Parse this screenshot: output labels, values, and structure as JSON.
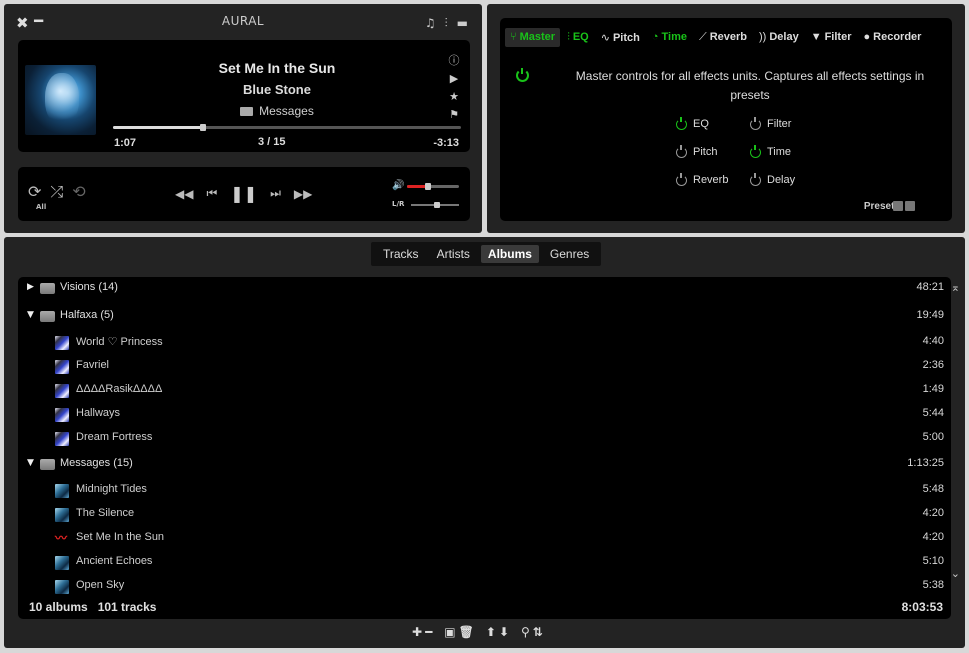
{
  "app": {
    "title": "AURAL"
  },
  "window": {
    "close_glyph": "✖",
    "minimize_glyph": "━"
  },
  "header_icons": [
    {
      "name": "playlist-view-icon",
      "glyph": "♫"
    },
    {
      "name": "effects-view-icon",
      "glyph": "⫶"
    },
    {
      "name": "layout-icon",
      "glyph": "▬"
    }
  ],
  "now_playing": {
    "title": "Set Me In the Sun",
    "artist": "Blue Stone",
    "album": "Messages",
    "elapsed": "1:07",
    "index": "3 / 15",
    "remaining": "-3:13",
    "progress_fraction": 0.26,
    "side_icons": [
      {
        "name": "info-icon",
        "glyph": "ⓘ"
      },
      {
        "name": "queue-icon",
        "glyph": "▶"
      },
      {
        "name": "favorite-icon",
        "glyph": "★"
      },
      {
        "name": "bookmark-icon",
        "glyph": "⚑"
      }
    ]
  },
  "controls": {
    "repeat_mode": "All",
    "left_icons": [
      {
        "name": "repeat-icon",
        "glyph": "⟳"
      },
      {
        "name": "shuffle-icon",
        "glyph": "⤮"
      },
      {
        "name": "shuffle-album-icon",
        "glyph": "⟲"
      }
    ],
    "transport": [
      {
        "name": "seek-backward-icon",
        "glyph": "◀◀"
      },
      {
        "name": "previous-track-icon",
        "glyph": "⏮"
      },
      {
        "name": "pause-icon",
        "glyph": "❚❚"
      },
      {
        "name": "next-track-icon",
        "glyph": "⏭"
      },
      {
        "name": "seek-forward-icon",
        "glyph": "▶▶"
      }
    ],
    "volume_icon": "🔊",
    "volume_fraction": 0.4,
    "balance_label": "L/R",
    "balance_fraction": 0.55
  },
  "effects": {
    "tabs": [
      {
        "label": "Master",
        "icon": "⑂",
        "state": "active"
      },
      {
        "label": "EQ",
        "icon": "⫶",
        "state": "on"
      },
      {
        "label": "Pitch",
        "icon": "∿",
        "state": "off"
      },
      {
        "label": "Time",
        "icon": "◔",
        "state": "on"
      },
      {
        "label": "Reverb",
        "icon": "⟋",
        "state": "off"
      },
      {
        "label": "Delay",
        "icon": "))",
        "state": "off"
      },
      {
        "label": "Filter",
        "icon": "▼",
        "state": "off"
      },
      {
        "label": "Recorder",
        "icon": "●",
        "state": "off"
      }
    ],
    "description": "Master controls for all effects units. Captures all effects settings in presets",
    "units": [
      {
        "label": "EQ",
        "on": true
      },
      {
        "label": "Filter",
        "on": false
      },
      {
        "label": "Pitch",
        "on": false
      },
      {
        "label": "Time",
        "on": true
      },
      {
        "label": "Reverb",
        "on": false
      },
      {
        "label": "Delay",
        "on": false
      }
    ],
    "presets_label": "Presets"
  },
  "playlist": {
    "tabs": [
      {
        "label": "Tracks",
        "active": false
      },
      {
        "label": "Artists",
        "active": false
      },
      {
        "label": "Albums",
        "active": true
      },
      {
        "label": "Genres",
        "active": false
      }
    ],
    "groups": [
      {
        "name": "Visions (14)",
        "duration": "48:21",
        "expanded": false,
        "tracks": []
      },
      {
        "name": "Halfaxa (5)",
        "duration": "19:49",
        "expanded": true,
        "art": "halfaxa",
        "tracks": [
          {
            "title": "World ♡ Princess",
            "duration": "4:40"
          },
          {
            "title": "Favriel",
            "duration": "2:36"
          },
          {
            "title": "ΔΔΔΔRasikΔΔΔΔ",
            "duration": "1:49"
          },
          {
            "title": "Hallways",
            "duration": "5:44"
          },
          {
            "title": "Dream Fortress",
            "duration": "5:00"
          }
        ]
      },
      {
        "name": "Messages  (15)",
        "duration": "1:13:25",
        "expanded": true,
        "art": "messages",
        "tracks": [
          {
            "title": "Midnight Tides",
            "duration": "5:48"
          },
          {
            "title": "The Silence",
            "duration": "4:20"
          },
          {
            "title": "Set Me In the Sun",
            "duration": "4:20",
            "playing": true
          },
          {
            "title": "Ancient Echoes",
            "duration": "5:10"
          },
          {
            "title": "Open Sky",
            "duration": "5:38"
          }
        ]
      }
    ],
    "summary": "10 albums   101 tracks",
    "total_duration": "8:03:53",
    "scroll_top_glyph": "⌅",
    "scroll_bottom_glyph": "⌄",
    "toolbar": [
      {
        "name": "add-icon",
        "glyph": "✚"
      },
      {
        "name": "remove-icon",
        "glyph": "━"
      },
      {
        "name": "save-icon",
        "glyph": "▣"
      },
      {
        "name": "clear-icon",
        "glyph": "🗑"
      },
      {
        "name": "move-up-icon",
        "glyph": "⬆"
      },
      {
        "name": "move-down-icon",
        "glyph": "⬇"
      },
      {
        "name": "search-icon",
        "glyph": "⚲"
      },
      {
        "name": "sort-icon",
        "glyph": "⇅"
      }
    ]
  }
}
